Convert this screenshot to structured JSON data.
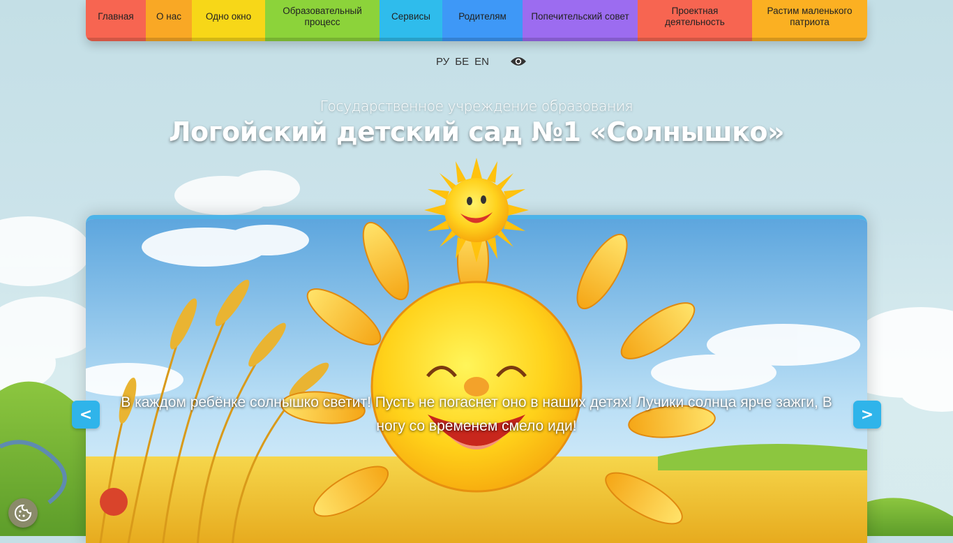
{
  "nav": {
    "items": [
      {
        "label": "Главная",
        "color": "#f76551"
      },
      {
        "label": "О нас",
        "color": "#f9a825"
      },
      {
        "label": "Одно окно",
        "color": "#f7d718"
      },
      {
        "label": "Образовательный процесс",
        "color": "#8cd33a"
      },
      {
        "label": "Сервисы",
        "color": "#2fbcec"
      },
      {
        "label": "Родителям",
        "color": "#3e98f7"
      },
      {
        "label": "Попечительский совет",
        "color": "#9c6cf0"
      },
      {
        "label": "Проектная деятельность",
        "color": "#f76551"
      },
      {
        "label": "Растим маленького патриота",
        "color": "#fbb022"
      }
    ]
  },
  "languages": [
    "РУ",
    "БЕ",
    "EN"
  ],
  "accessibility_icon": "eye-icon",
  "header": {
    "subtitle": "Государственное учреждение образования",
    "title": "Логойский детский сад №1 «Солнышко»"
  },
  "slider": {
    "caption": "В каждом ребёнке солнышко светит! Пусть не погаснет оно в наших детях! Лучики солнца ярче зажги, В ногу со временем смело иди!",
    "prev_label": "<",
    "next_label": ">",
    "accent_color": "#4db3e8"
  },
  "cookie_icon": "cookie-icon"
}
